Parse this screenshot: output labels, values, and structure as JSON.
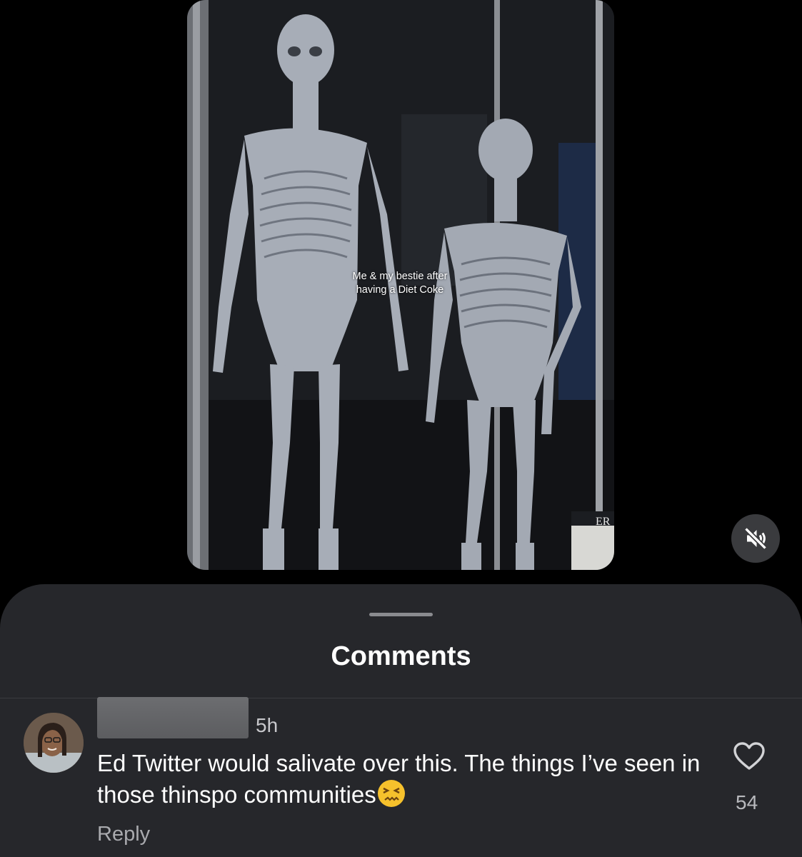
{
  "video": {
    "caption": "Me & my bestie after having a Diet Coke",
    "sign_fragment": "ER"
  },
  "controls": {
    "mute_icon": "speaker-muted-icon"
  },
  "comments_sheet": {
    "title": "Comments",
    "comments": [
      {
        "timestamp": "5h",
        "text": "Ed Twitter would salivate over this. The things I’ve seen in those thinspo communities",
        "emoji": "confounded-face",
        "reply_label": "Reply",
        "like_count": "54",
        "like_icon": "heart-outline-icon"
      }
    ]
  }
}
